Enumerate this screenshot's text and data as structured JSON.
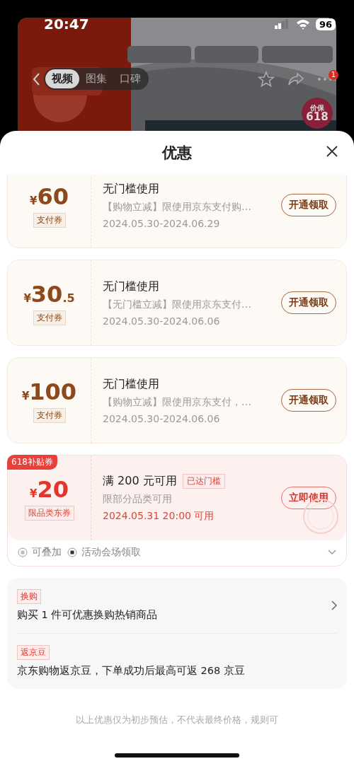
{
  "status_bar": {
    "time": "20:47",
    "battery": "96"
  },
  "product_nav": {
    "tabs": [
      {
        "label": "视频",
        "selected": true
      },
      {
        "label": "图集",
        "selected": false
      },
      {
        "label": "口碑",
        "selected": false
      }
    ],
    "notification_count": "1",
    "badge": {
      "line_1": "价保",
      "line_2": "618"
    }
  },
  "sheet": {
    "title": "优惠"
  },
  "coupons": [
    {
      "kind": "pay",
      "currency": "¥",
      "amount": "60",
      "label": "支付券",
      "title": "无门槛使用",
      "description": "【购物立减】限使用京东支付购…",
      "date": "2024.05.30-2024.06.29",
      "button": "开通领取"
    },
    {
      "kind": "pay",
      "currency": "¥",
      "amount": "30",
      "decimal": ".5",
      "label": "支付券",
      "title": "无门槛使用",
      "description": "【无门槛立减】限使用京东支付…",
      "date": "2024.05.30-2024.06.06",
      "button": "开通领取"
    },
    {
      "kind": "pay",
      "currency": "¥",
      "amount": "100",
      "label": "支付券",
      "title": "无门槛使用",
      "description": "【购物立减】限使用京东支付，…",
      "date": "2024.05.30-2024.06.06",
      "button": "开通领取"
    },
    {
      "kind": "subsidy",
      "corner_tag": "618补贴券",
      "currency": "¥",
      "amount": "20",
      "label": "限品类东券",
      "title": "满 200 元可用",
      "status_tag": "已达门槛",
      "description": "限部分品类可用",
      "date": "2024.05.31 20:00 可用",
      "button": "立即使用",
      "features": [
        "可叠加",
        "活动会场领取"
      ]
    }
  ],
  "promotions": [
    {
      "tag": "换购",
      "text": "购买 1 件可优惠换购热销商品",
      "has_arrow": true
    },
    {
      "tag": "返京豆",
      "text": "京东购物返京豆，下单成功后最高可返 268 京豆",
      "has_arrow": false
    }
  ],
  "footer_note": "以上优惠仅为初步预估，不代表最终价格，规则可"
}
